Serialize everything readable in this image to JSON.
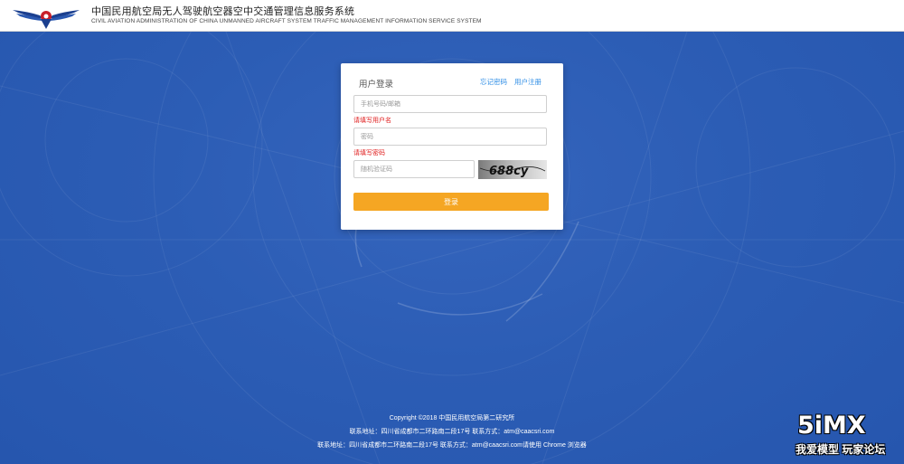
{
  "header": {
    "title_cn": "中国民用航空局无人驾驶航空器空中交通管理信息服务系统",
    "title_en": "CIVIL AVIATION ADMINISTRATION OF CHINA UNMANNED AIRCRAFT SYSTEM TRAFFIC MANAGEMENT INFORMATION SERVICE SYSTEM",
    "logo_icon": "caac-wings-logo-icon"
  },
  "login": {
    "title": "用户登录",
    "forgot_password": "忘记密码",
    "register": "用户注册",
    "username_placeholder": "手机号码/邮箱",
    "username_error": "请填写用户名",
    "password_placeholder": "密码",
    "password_error": "请填写密码",
    "captcha_placeholder": "随机验证码",
    "captcha_text": "688cy",
    "submit_label": "登录"
  },
  "footer": {
    "copyright": "Copyright ©2018 中国民用航空局第二研究所",
    "contact_1": "联系地址：四川省成都市二环路南二段17号 联系方式：atm@caacsri.com",
    "contact_2": "联系地址：四川省成都市二环路南二段17号 联系方式：atm@caacsri.com请使用 Chrome 浏览器"
  },
  "watermark": {
    "logo": "5iMX",
    "subtitle": "我爱模型 玩家论坛"
  },
  "colors": {
    "background": "#2b5cb4",
    "accent": "#f5a623",
    "link": "#2f8ee6",
    "error": "#e02020"
  }
}
